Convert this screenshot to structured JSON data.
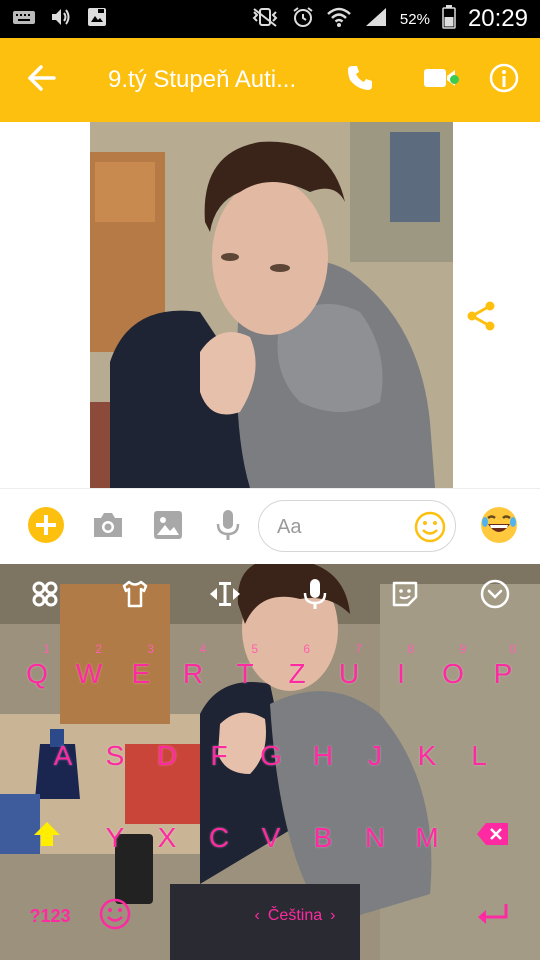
{
  "status_bar": {
    "battery": "52%",
    "time": "20:29",
    "icons": [
      "keyboard-icon",
      "volume-icon",
      "photo-save-icon",
      "mute-vibrate-icon",
      "alarm-icon",
      "wifi-icon",
      "signal-icon",
      "battery-icon"
    ]
  },
  "header": {
    "title": "9.tý Stupeň Auti...",
    "icons": [
      "back-arrow-icon",
      "phone-icon",
      "video-camera-icon",
      "info-icon"
    ],
    "online": true
  },
  "conversation": {
    "message": {
      "type": "photo",
      "icon": "share-icon"
    }
  },
  "composer": {
    "placeholder": "Aa",
    "icons": [
      "plus-icon",
      "camera-icon",
      "gallery-icon",
      "microphone-icon",
      "emoji-icon",
      "laughing-emoji-icon"
    ]
  },
  "keyboard": {
    "toolbar": [
      "clover-icon",
      "theme-shirt-icon",
      "cursor-icon",
      "microphone-icon",
      "sticker-icon",
      "collapse-icon"
    ],
    "row1": [
      {
        "label": "Q",
        "hint": "1"
      },
      {
        "label": "W",
        "hint": "2"
      },
      {
        "label": "E",
        "hint": "3"
      },
      {
        "label": "R",
        "hint": "4"
      },
      {
        "label": "T",
        "hint": "5"
      },
      {
        "label": "Z",
        "hint": "6"
      },
      {
        "label": "U",
        "hint": "7"
      },
      {
        "label": "I",
        "hint": "8"
      },
      {
        "label": "O",
        "hint": "9"
      },
      {
        "label": "P",
        "hint": "0"
      }
    ],
    "row2": [
      "A",
      "S",
      "D",
      "F",
      "G",
      "H",
      "J",
      "K",
      "L"
    ],
    "row3": [
      "Y",
      "X",
      "C",
      "V",
      "B",
      "N",
      "M"
    ],
    "symbols_key": "?123",
    "space_label": "Čeština",
    "space_arrows": [
      "‹",
      "›"
    ],
    "colors": {
      "key_text": "#ff2aa1",
      "accent": "#FEC00E",
      "shift": "#ffee00"
    }
  }
}
